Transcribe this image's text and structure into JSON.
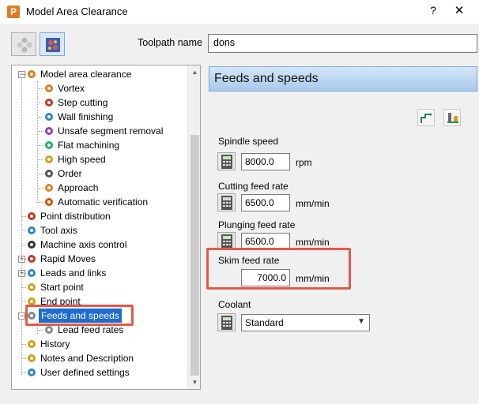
{
  "window": {
    "app_icon_letter": "P",
    "title": "Model Area Clearance",
    "help": "?",
    "close": "✕"
  },
  "toolbar": {
    "toolpath_label": "Toolpath name",
    "toolpath_value": "dons"
  },
  "tree": {
    "items": [
      {
        "label": "Model area clearance",
        "icon": "area-clearance-icon",
        "color": "#e07b1e"
      },
      {
        "label": "Vortex",
        "icon": "vortex-icon",
        "color": "#e07b1e"
      },
      {
        "label": "Step cutting",
        "icon": "step-cutting-icon",
        "color": "#c0392b"
      },
      {
        "label": "Wall finishing",
        "icon": "wall-finishing-icon",
        "color": "#2e86c1"
      },
      {
        "label": "Unsafe segment removal",
        "icon": "unsafe-segment-icon",
        "color": "#8e44ad"
      },
      {
        "label": "Flat machining",
        "icon": "flat-machining-icon",
        "color": "#27ae60"
      },
      {
        "label": "High speed",
        "icon": "high-speed-icon",
        "color": "#d4a017"
      },
      {
        "label": "Order",
        "icon": "order-icon",
        "color": "#555555"
      },
      {
        "label": "Approach",
        "icon": "approach-icon",
        "color": "#e67e22"
      },
      {
        "label": "Automatic verification",
        "icon": "verification-icon",
        "color": "#d35400"
      },
      {
        "label": "Point distribution",
        "icon": "point-distribution-icon",
        "color": "#c0392b"
      },
      {
        "label": "Tool axis",
        "icon": "tool-axis-icon",
        "color": "#2e86c1"
      },
      {
        "label": "Machine axis control",
        "icon": "machine-axis-icon",
        "color": "#333333"
      },
      {
        "label": "Rapid Moves",
        "icon": "rapid-moves-icon",
        "color": "#c0392b"
      },
      {
        "label": "Leads and links",
        "icon": "leads-links-icon",
        "color": "#2e86c1"
      },
      {
        "label": "Start point",
        "icon": "start-point-icon",
        "color": "#d4a017"
      },
      {
        "label": "End point",
        "icon": "end-point-icon",
        "color": "#d4a017"
      },
      {
        "label": "Feeds and speeds",
        "icon": "feeds-speeds-icon",
        "color": "#7f8c8d"
      },
      {
        "label": "Lead feed rates",
        "icon": "lead-feed-icon",
        "color": "#7f8c8d"
      },
      {
        "label": "History",
        "icon": "history-icon",
        "color": "#d4a017"
      },
      {
        "label": "Notes and Description",
        "icon": "notes-icon",
        "color": "#d4a017"
      },
      {
        "label": "User defined settings",
        "icon": "user-settings-icon",
        "color": "#2e86c1"
      }
    ]
  },
  "panel": {
    "header": "Feeds and speeds",
    "spindle": {
      "label": "Spindle speed",
      "value": "8000.0",
      "unit": "rpm"
    },
    "cutting": {
      "label": "Cutting feed rate",
      "value": "6500.0",
      "unit": "mm/min"
    },
    "plunging": {
      "label": "Plunging feed rate",
      "value": "6500.0",
      "unit": "mm/min"
    },
    "skim": {
      "label": "Skim feed rate",
      "value": "7000.0",
      "unit": "mm/min"
    },
    "coolant": {
      "label": "Coolant",
      "value": "Standard"
    }
  },
  "colors": {
    "highlight": "#e05a4a",
    "selection": "#1e6ccf",
    "header": "#a9c9ea"
  }
}
